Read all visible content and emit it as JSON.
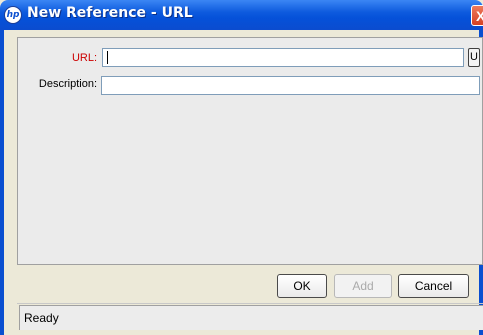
{
  "window": {
    "title": "New Reference - URL",
    "app_icon": "hp-logo-icon",
    "close_glyph": "X"
  },
  "form": {
    "url_label": "URL:",
    "url_value": "",
    "url_button_label": "U",
    "description_label": "Description:",
    "description_value": ""
  },
  "buttons": {
    "ok_label": "OK",
    "add_label": "Add",
    "cancel_label": "Cancel"
  },
  "status": {
    "text": "Ready"
  },
  "colors": {
    "title_bar": "#0551d9",
    "required_label": "#cc0000"
  }
}
